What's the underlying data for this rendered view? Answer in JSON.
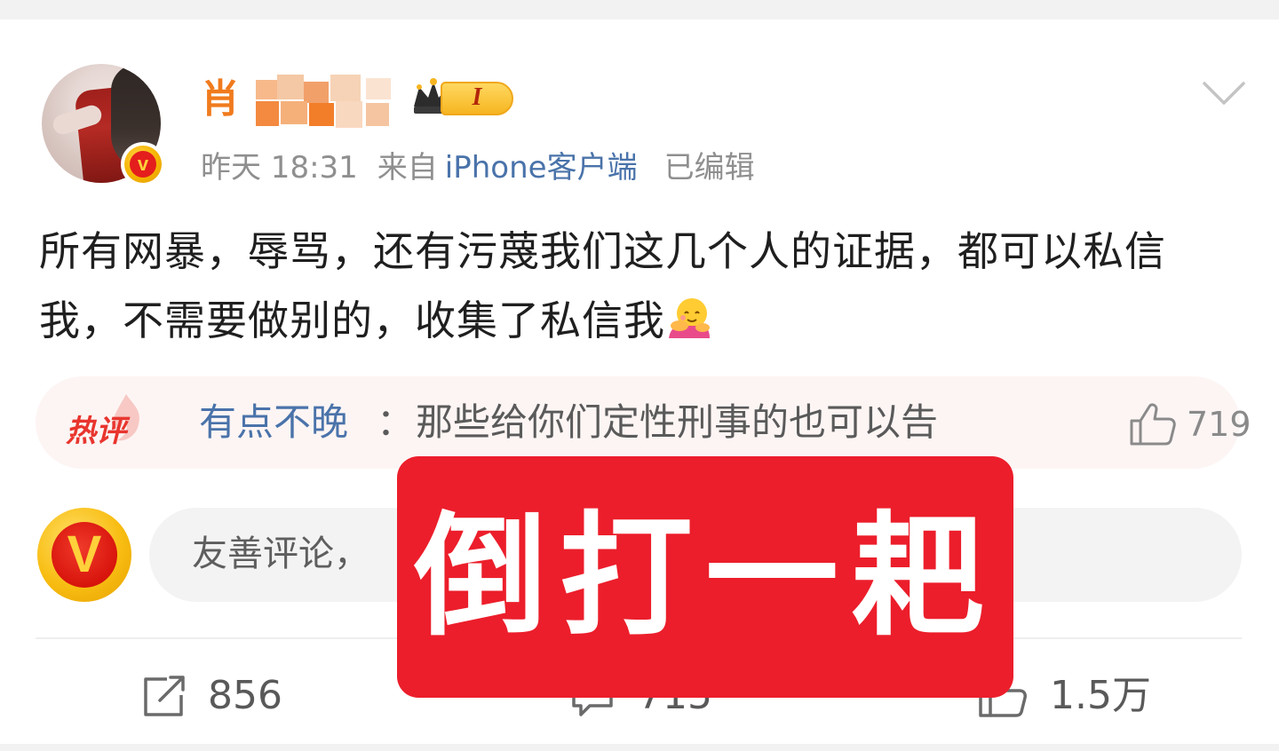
{
  "post": {
    "author": {
      "name_visible": "肖",
      "member_level": "I"
    },
    "meta": {
      "time": "昨天 18:31",
      "from_label": "来自",
      "device": "iPhone客户端",
      "edited": "已编辑"
    },
    "text": "所有网暴，辱骂，还有污蔑我们这几个人的证据，都可以私信我，不需要做别的，收集了私信我"
  },
  "hot_comment": {
    "badge": "热评",
    "user": "有点不晚",
    "separator": "：",
    "text": "那些给你们定性刑事的也可以告",
    "likes": "719"
  },
  "compose": {
    "placeholder": "友善评论，"
  },
  "actions": {
    "share_count": "856",
    "comment_count": "715",
    "like_count": "1.5万"
  },
  "overlay": {
    "text": "倒打一耙"
  },
  "colors": {
    "username": "#f07b1d",
    "link_blue": "#4a73aa",
    "overlay_red": "#ec1e2b",
    "hot_red": "#e8352e"
  }
}
